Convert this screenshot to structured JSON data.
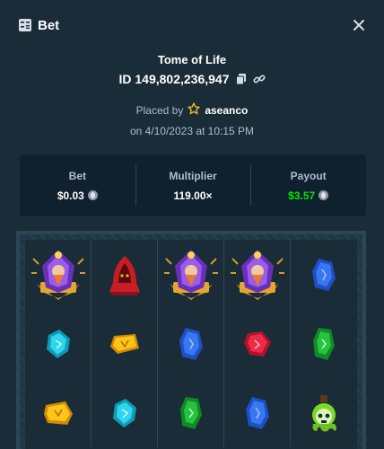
{
  "header": {
    "title": "Bet"
  },
  "game": {
    "name": "Tome of Life"
  },
  "bet": {
    "id": "ID 149,802,236,947",
    "placed_by_prefix": "Placed by",
    "username": "aseanco",
    "date": "on 4/10/2023 at 10:15 PM"
  },
  "stats": {
    "bet_label": "Bet",
    "bet_value": "$0.03",
    "multiplier_label": "Multiplier",
    "multiplier_value": "119.00×",
    "payout_label": "Payout",
    "payout_value": "$3.57"
  },
  "colors": {
    "background": "#1a2c38",
    "panel": "#0f212e",
    "muted_text": "#b1bad3",
    "payout_green": "#00e701"
  },
  "reels": [
    [
      "wizard-symbol",
      "red-hood-symbol",
      "wizard-symbol",
      "wizard-symbol",
      "blue-gem-symbol"
    ],
    [
      "cyan-gem-symbol",
      "gold-rune-symbol",
      "blue-gem-symbol",
      "red-gem-symbol",
      "green-gem-symbol"
    ],
    [
      "gold-rune-symbol",
      "cyan-gem-symbol",
      "green-gem-symbol",
      "blue-gem-symbol",
      "potion-skull-symbol"
    ]
  ]
}
